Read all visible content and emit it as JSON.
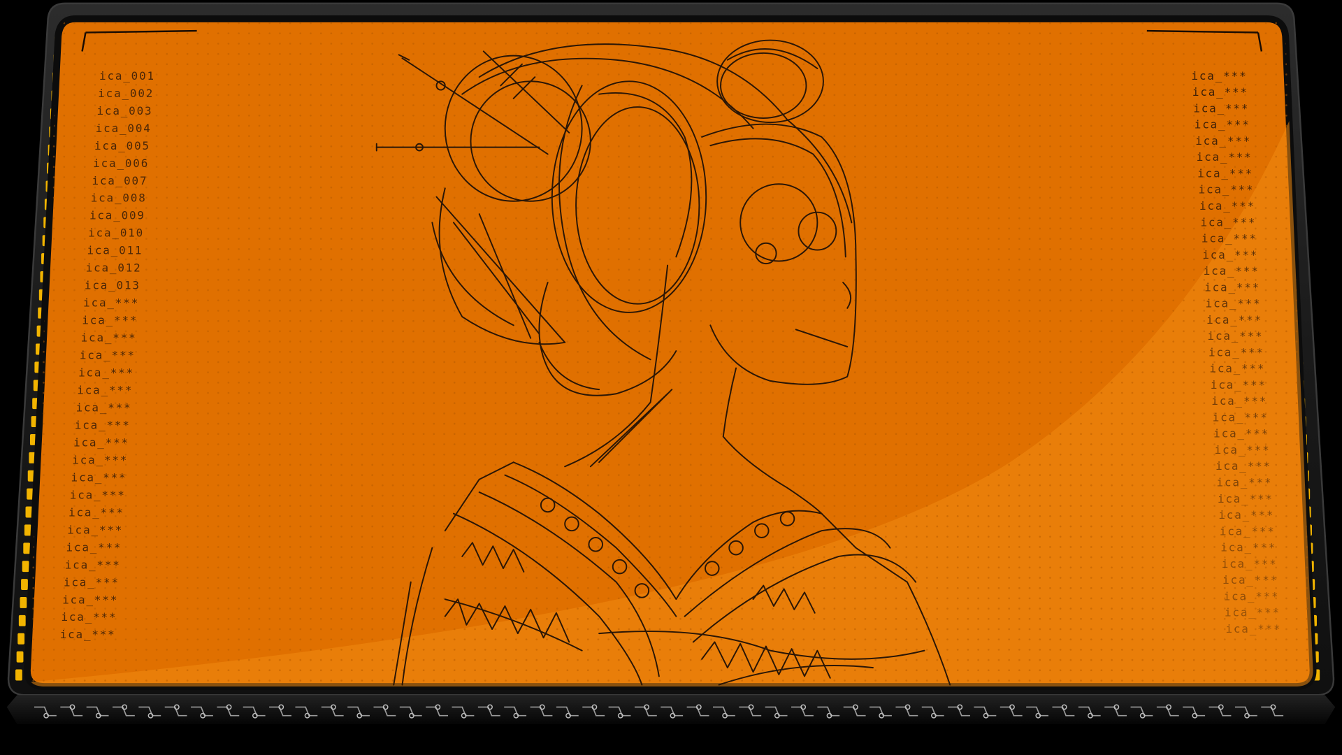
{
  "colors": {
    "background": "#000000",
    "bezel": "#1b1b1b",
    "bezel_edge": "#3a3a3a",
    "screen_orange": "#e07000",
    "screen_glare": "#f08a10",
    "screen_border": "#0c0c0c",
    "bezel_light": "#f2b400",
    "line_art": "#2a1606",
    "label_text": "#3a1e08"
  },
  "left_labels": [
    "ica_001",
    "ica_002",
    "ica_003",
    "ica_004",
    "ica_005",
    "ica_006",
    "ica_007",
    "ica_008",
    "ica_009",
    "ica_010",
    "ica_011",
    "ica_012",
    "ica_013",
    "ica_***",
    "ica_***",
    "ica_***",
    "ica_***",
    "ica_***",
    "ica_***",
    "ica_***",
    "ica_***",
    "ica_***",
    "ica_***",
    "ica_***",
    "ica_***",
    "ica_***",
    "ica_***",
    "ica_***",
    "ica_***",
    "ica_***",
    "ica_***",
    "ica_***",
    "ica_***"
  ],
  "right_labels": [
    "ica_***",
    "ica_***",
    "ica_***",
    "ica_***",
    "ica_***",
    "ica_***",
    "ica_***",
    "ica_***",
    "ica_***",
    "ica_***",
    "ica_***",
    "ica_***",
    "ica_***",
    "ica_***",
    "ica_***",
    "ica_***",
    "ica_***",
    "ica_***",
    "ica_***",
    "ica_***",
    "ica_***",
    "ica_***",
    "ica_***",
    "ica_***",
    "ica_***",
    "ica_***",
    "ica_***",
    "ica_***",
    "ica_***",
    "ica_***",
    "ica_***",
    "ica_***",
    "ica_***",
    "ica_***",
    "ica_***"
  ],
  "icons": {
    "bezel_lights": "indicator-light-icon",
    "circuit_strip": "circuit-pattern-icon",
    "illustration": "geisha-line-art-icon"
  }
}
